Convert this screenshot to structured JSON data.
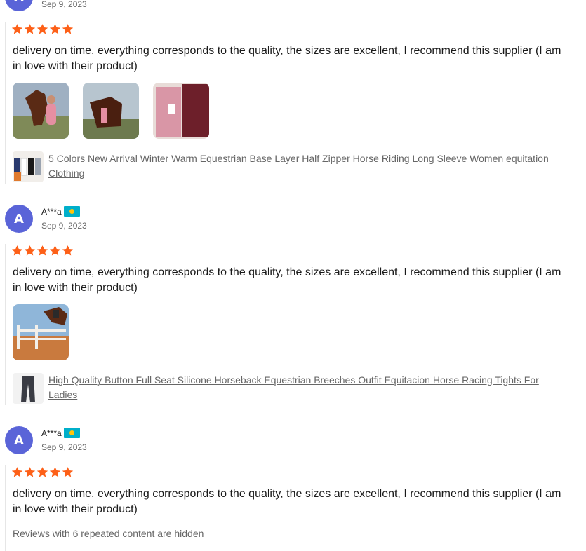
{
  "reviews": [
    {
      "avatar_letter": "A",
      "name": "",
      "date": "Sep 9, 2023",
      "rating": 5,
      "text": "delivery on time, everything corresponds to the quality, the sizes are excellent, I recommend this supplier (I am in love with their product)",
      "photos": [
        "horse-photo",
        "horse-photo",
        "pink-garment-photo"
      ],
      "product": "5 Colors New Arrival Winter Warm Equestrian Base Layer Half Zipper Horse Riding Long Sleeve Women equitation Clothing"
    },
    {
      "avatar_letter": "A",
      "name": "A***a",
      "date": "Sep 9, 2023",
      "rating": 5,
      "text": "delivery on time, everything corresponds to the quality, the sizes are excellent, I recommend this supplier (I am in love with their product)",
      "photos": [
        "horse-jump-photo"
      ],
      "product": "High Quality Button Full Seat Silicone Horseback Equestrian Breeches Outfit Equitacion Horse Racing Tights For Ladies"
    },
    {
      "avatar_letter": "A",
      "name": "A***a",
      "date": "Sep 9, 2023",
      "rating": 5,
      "text": "delivery on time, everything corresponds to the quality, the sizes are excellent, I recommend this supplier (I am in love with their product)"
    }
  ],
  "hidden_note": "Reviews with 6 repeated content are hidden",
  "colors": {
    "star": "#fd6018",
    "avatar": "#5a64d8",
    "flag": "#00afca"
  }
}
